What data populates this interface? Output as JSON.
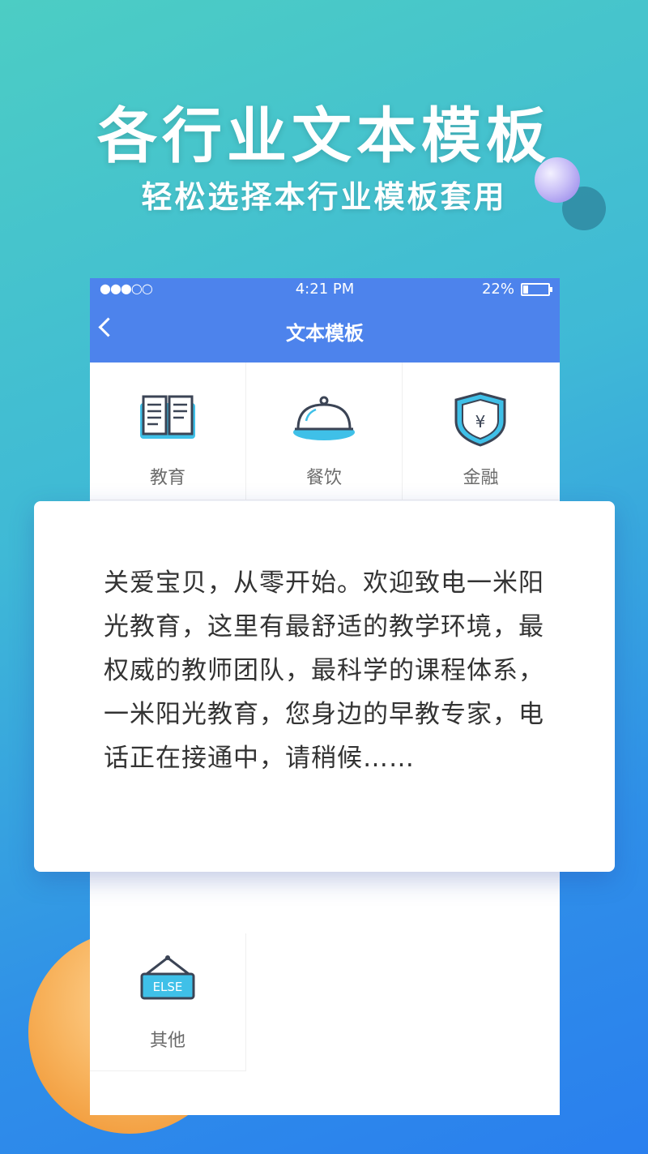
{
  "promo": {
    "title": "各行业文本模板",
    "subtitle": "轻松选择本行业模板套用"
  },
  "status_bar": {
    "signal": "●●●○○",
    "time": "4:21 PM",
    "battery": "22%"
  },
  "nav": {
    "title": "文本模板"
  },
  "categories": [
    {
      "label": "教育",
      "icon": "book-icon"
    },
    {
      "label": "餐饮",
      "icon": "food-cloche-icon"
    },
    {
      "label": "金融",
      "icon": "yuan-shield-icon"
    },
    {
      "label": "其他",
      "icon": "else-sign-icon"
    }
  ],
  "icon_texts": {
    "yuan": "¥",
    "else": "ELSE"
  },
  "template_card": {
    "text": "关爱宝贝，从零开始。欢迎致电一米阳光教育，这里有最舒适的教学环境，最权威的教师团队，最科学的课程体系，一米阳光教育，您身边的早教专家，电话正在接通中，请稍候……"
  },
  "colors": {
    "header": "#4d83ec",
    "icon_accent": "#3fc0e8",
    "icon_stroke": "#3b4455"
  }
}
